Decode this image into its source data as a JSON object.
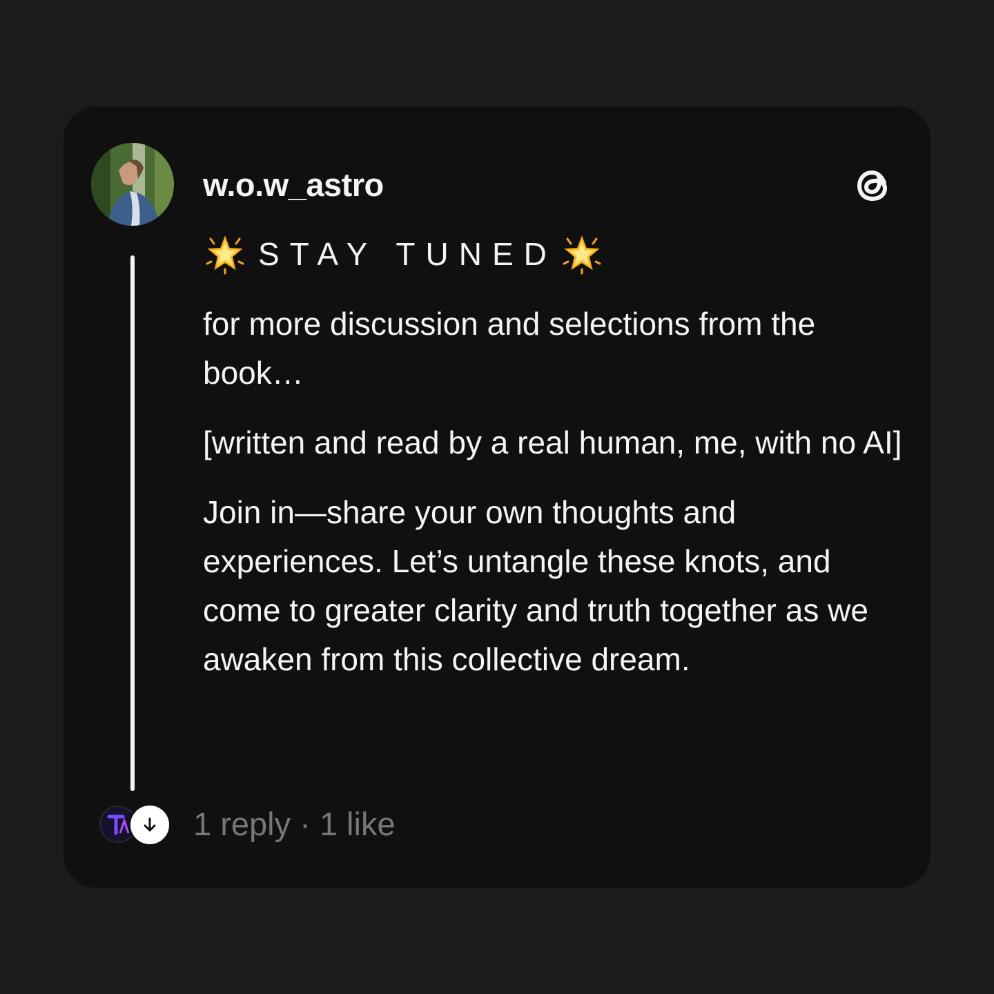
{
  "post": {
    "username": "w.o.w_astro",
    "headline": "STAY TUNED",
    "headline_icon": "glowing-star-emoji",
    "paragraphs": [
      "for more discussion and selections from the book…",
      "[written and read by a real human, me, with no AI]",
      "Join in—share your own thoughts and experiences. Let’s untangle these knots, and come to greater clarity and truth together as we awaken from this collective dream."
    ]
  },
  "footer": {
    "replies": "1 reply",
    "separator": "·",
    "likes": "1 like"
  },
  "icons": {
    "brand": "threads-logo-icon",
    "expand": "arrow-down-icon"
  },
  "colors": {
    "background": "#1c1c1c",
    "card": "#101010",
    "text": "#f3f5f7",
    "muted": "#777777"
  }
}
